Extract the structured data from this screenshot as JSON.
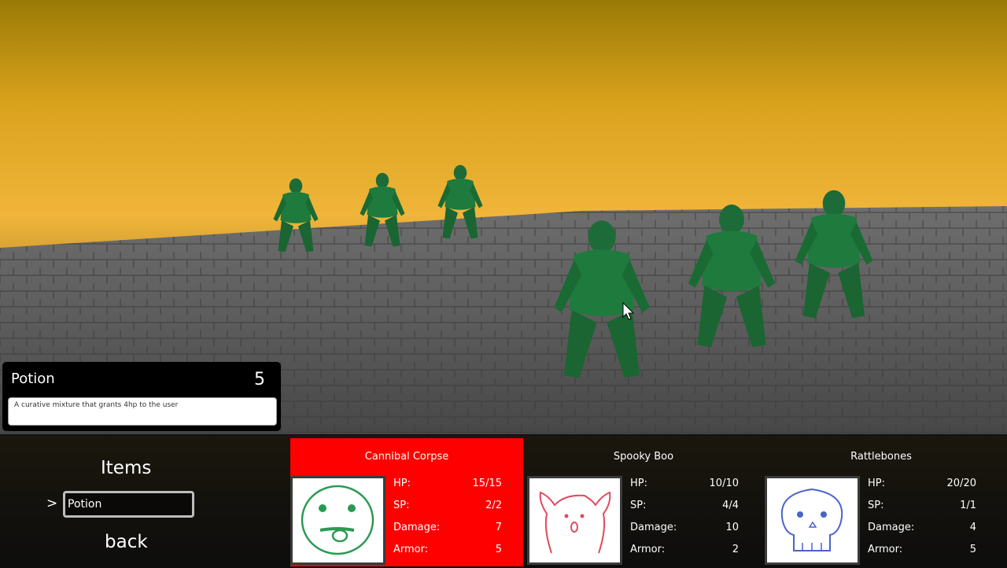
{
  "item_info": {
    "name": "Potion",
    "quantity": "5",
    "description": "A curative mixture that grants 4hp to the user"
  },
  "menu": {
    "title": "Items",
    "cursor": ">",
    "selected_item": "Potion",
    "back_label": "back"
  },
  "party": [
    {
      "name": "Cannibal Corpse",
      "active": true,
      "portrait_icon": "tongue-face-icon",
      "stats": [
        {
          "label": "HP:",
          "value": "15/15"
        },
        {
          "label": "SP:",
          "value": "2/2"
        },
        {
          "label": "Damage:",
          "value": "7"
        },
        {
          "label": "Armor:",
          "value": "5"
        }
      ]
    },
    {
      "name": "Spooky Boo",
      "active": false,
      "portrait_icon": "ghost-icon",
      "stats": [
        {
          "label": "HP:",
          "value": "10/10"
        },
        {
          "label": "SP:",
          "value": "4/4"
        },
        {
          "label": "Damage:",
          "value": "10"
        },
        {
          "label": "Armor:",
          "value": "2"
        }
      ]
    },
    {
      "name": "Rattlebones",
      "active": false,
      "portrait_icon": "skull-icon",
      "stats": [
        {
          "label": "HP:",
          "value": "20/20"
        },
        {
          "label": "SP:",
          "value": "1/1"
        },
        {
          "label": "Damage:",
          "value": "4"
        },
        {
          "label": "Armor:",
          "value": "5"
        }
      ]
    }
  ],
  "colors": {
    "active_card": "#ff0000",
    "ninja_green": "#1f6b3a"
  }
}
